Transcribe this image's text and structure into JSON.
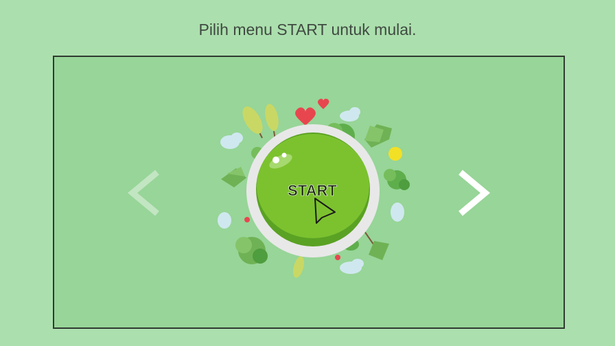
{
  "instruction": "Pilih menu START untuk mulai.",
  "start_button": {
    "label": "START"
  },
  "nav": {
    "prev_icon": "chevron-left-icon",
    "next_icon": "chevron-right-icon"
  },
  "colors": {
    "page_bg": "#acdfae",
    "stage_bg": "#97d598",
    "button_green": "#7cc22f",
    "ring": "#e6e6e6"
  }
}
